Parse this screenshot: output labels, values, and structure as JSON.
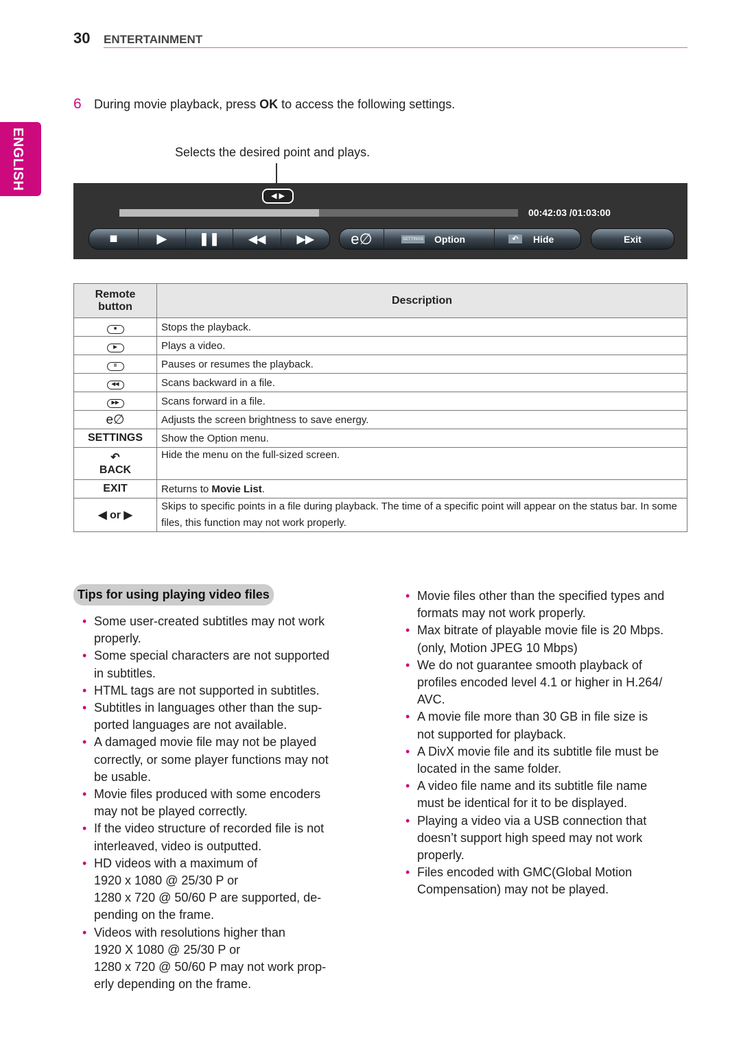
{
  "header": {
    "page_number": "30",
    "section": "ENTERTAINMENT"
  },
  "side_tab": "ENGLISH",
  "accent_color": "#cc0a7e",
  "step": {
    "number": "6",
    "text_before": "During movie playback, press ",
    "bold": "OK",
    "text_after": " to access the following settings."
  },
  "callout": "Selects the desired point and plays.",
  "player": {
    "progress_percent": 50,
    "time": "00:42:03 /01:03:00",
    "settings_icon_text": "SETTINGS",
    "option_label": "Option",
    "hide_label": "Hide",
    "exit_label": "Exit",
    "energy_icon": "e∅"
  },
  "table": {
    "headers": [
      "Remote button",
      "Description"
    ],
    "rows": [
      {
        "icon": "stop-icon",
        "glyph": "■",
        "desc": "Stops the playback."
      },
      {
        "icon": "play-icon",
        "glyph": "▶",
        "desc": "Plays a video."
      },
      {
        "icon": "pause-icon",
        "glyph": "II",
        "desc": "Pauses or resumes the playback."
      },
      {
        "icon": "rewind-icon",
        "glyph": "◀◀",
        "desc": "Scans backward in a file."
      },
      {
        "icon": "fast-forward-icon",
        "glyph": "▶▶",
        "desc": "Scans forward in a file."
      },
      {
        "icon": "energy-saving-icon",
        "glyph": "e∅",
        "desc": "Adjusts the screen brightness to save energy."
      },
      {
        "key": "SETTINGS",
        "desc": "Show the Option menu."
      },
      {
        "icon": "back-icon",
        "glyph": "↶",
        "key": "BACK",
        "desc": "Hide the menu on the full-sized screen."
      },
      {
        "key": "EXIT",
        "desc_before": "Returns to ",
        "desc_bold": "Movie List",
        "desc_after": "."
      },
      {
        "key": "◀ or ▶",
        "desc": "Skips to specific points in a file during playback. The time of a specific point will appear on the status bar. In some files, this function may not work properly."
      }
    ]
  },
  "tips": {
    "title": "Tips for using playing video files",
    "left": [
      [
        "Some user-created subtitles may not work",
        "properly."
      ],
      [
        "Some special characters are not supported",
        "in subtitles."
      ],
      [
        "HTML tags are not supported in subtitles."
      ],
      [
        "Subtitles in languages other than the sup-",
        "ported languages are not available."
      ],
      [
        "A damaged movie file may not be played",
        "correctly, or some player functions may not",
        "be usable."
      ],
      [
        "Movie files produced with some encoders",
        "may not be played correctly."
      ],
      [
        "If the video structure of recorded file is not",
        "interleaved, video is outputted."
      ],
      [
        "HD videos with a maximum of",
        "1920 x 1080 @ 25/30 P or",
        "1280 x 720 @ 50/60 P are supported, de-",
        "pending on the frame."
      ],
      [
        "Videos with resolutions higher than",
        "1920 X 1080 @ 25/30 P or",
        "1280 x 720 @ 50/60 P may not work prop-",
        "erly depending on the frame."
      ]
    ],
    "right": [
      [
        "Movie files other than the specified types and",
        "formats may not work properly."
      ],
      [
        "Max bitrate of playable movie file is 20 Mbps.",
        "(only, Motion JPEG 10 Mbps)"
      ],
      [
        "We do not guarantee smooth playback of",
        "profiles encoded level 4.1 or higher in H.264/",
        "AVC."
      ],
      [
        "A movie file more than 30 GB in file size is",
        "not supported for playback."
      ],
      [
        "A DivX movie file and its subtitle file must be",
        "located in the same folder."
      ],
      [
        "A video file name and its subtitle file name",
        "must be identical for it to be displayed."
      ],
      [
        "Playing a video via a USB connection that",
        "doesn’t support high speed may not work",
        "properly."
      ],
      [
        "Files encoded with GMC(Global Motion",
        "Compensation) may not be played."
      ]
    ]
  }
}
